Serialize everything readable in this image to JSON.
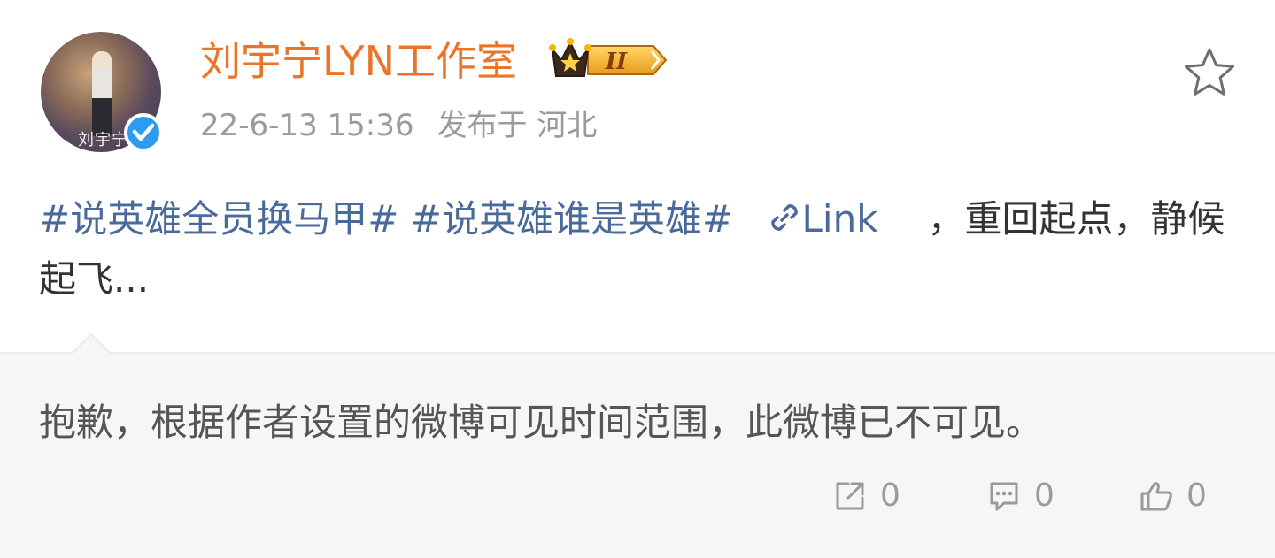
{
  "post": {
    "author": "刘宇宁LYN工作室",
    "badge_level": "II",
    "timestamp": "22-6-13 15:36",
    "location": "发布于 河北",
    "hashtags": [
      "#说英雄全员换马甲#",
      "#说英雄谁是英雄#"
    ],
    "link_label": "Link",
    "text_after_link": "，重回起点，静候起飞..."
  },
  "retweet": {
    "notice": "抱歉，根据作者设置的微博可见时间范围，此微博已不可见。",
    "share_count": "0",
    "comment_count": "0",
    "like_count": "0"
  },
  "icons": {
    "favorite": "star-outline-icon",
    "verified": "verified-check-icon",
    "badge": "crown-badge-icon",
    "link": "link-chain-icon",
    "share": "share-icon",
    "comment": "comment-icon",
    "like": "thumbs-up-icon"
  },
  "colors": {
    "author": "#eb7428",
    "hashtag": "#4a6a9c",
    "verified": "#2d9cf0",
    "badge_gold": "#f2b430",
    "retweet_bg": "#f6f6f6"
  }
}
